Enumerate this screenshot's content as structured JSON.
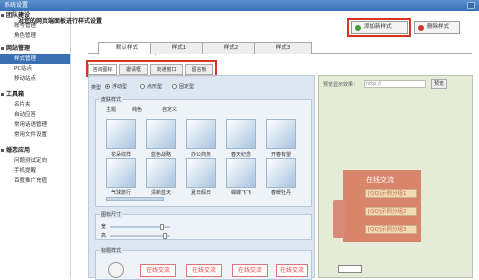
{
  "window": {
    "title": "系统设置"
  },
  "sidebar": {
    "sections": [
      {
        "title": "团队建设",
        "items": [
          {
            "label": "账号管理"
          },
          {
            "label": "角色管理"
          }
        ]
      },
      {
        "title": "网站管理",
        "items": [
          {
            "label": "样式管理",
            "active": true
          },
          {
            "label": "PC站点"
          },
          {
            "label": "移动站点"
          }
        ]
      },
      {
        "title": "工具箱",
        "items": [
          {
            "label": "名片夹"
          },
          {
            "label": "自动应答"
          },
          {
            "label": "常用话语管理"
          },
          {
            "label": "常用文件设置"
          }
        ]
      },
      {
        "title": "婚恋应用",
        "items": [
          {
            "label": "问题测试定向"
          },
          {
            "label": "手机提醒"
          },
          {
            "label": "百度推广充值"
          }
        ]
      }
    ]
  },
  "header": {
    "title": "对您的网页端面板进行样式设置",
    "add_label": "添加新样式",
    "delete_label": "删除样式"
  },
  "style_tabs": [
    "默认样式",
    "样式1",
    "样式2",
    "样式3"
  ],
  "sub_tabs": [
    "咨询图标",
    "邀请框",
    "向通窗口",
    "留言板"
  ],
  "panel": {
    "type_label": "类型",
    "type_options": [
      "浮动型",
      "点形型",
      "固定型"
    ],
    "skin_section": "皮肤样式",
    "skin_tabs": [
      "主题",
      "纯色",
      "自定义"
    ],
    "themes": [
      "花朵纹样",
      "蓝色战略",
      "办公商务",
      "春天纪念",
      "开春有望",
      "气球旅行",
      "清新蓝天",
      "夏日假日",
      "蝴蝶飞飞",
      "春暖牡丹"
    ],
    "size_section": "图标尺寸",
    "width_label": "宽",
    "height_label": "高",
    "title_section": "标题样式",
    "chat_text": "在线交流"
  },
  "preview": {
    "url_label": "预览显示效果：",
    "url_value": "http://",
    "preview_button": "预览",
    "head": "在线交流",
    "qq_items": [
      "[QQ]示例分组1",
      "[QQ]示例分组2",
      "[QQ]示例分组3"
    ]
  },
  "colors": {
    "accent": "#3b6fb3",
    "highlight": "#dd3322"
  }
}
